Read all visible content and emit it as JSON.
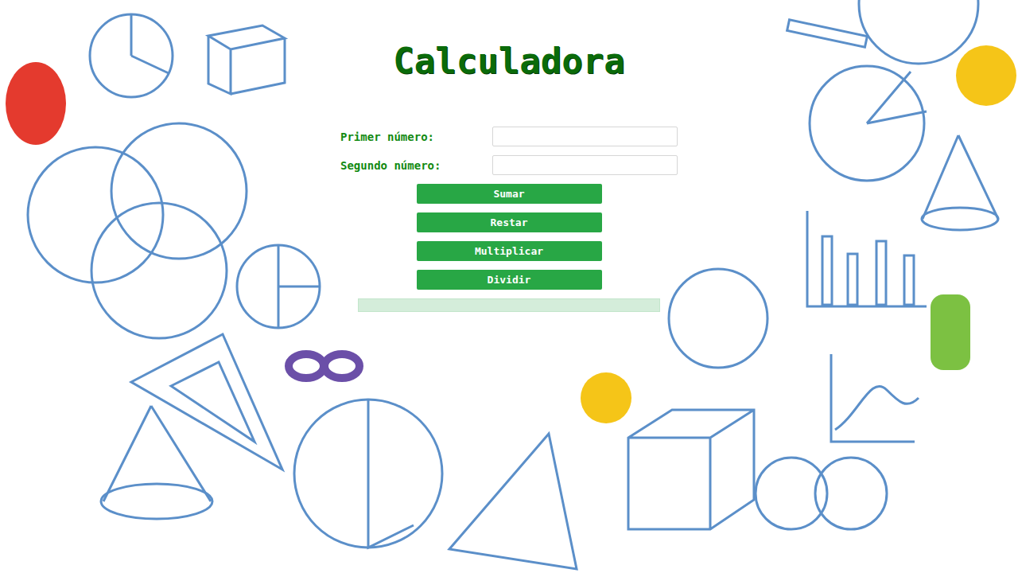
{
  "title": "Calculadora",
  "fields": [
    {
      "label": "Primer número:",
      "value": ""
    },
    {
      "label": "Segundo número:",
      "value": ""
    }
  ],
  "buttons": [
    "Sumar",
    "Restar",
    "Multiplicar",
    "Dividir"
  ],
  "result": {
    "text": ""
  }
}
